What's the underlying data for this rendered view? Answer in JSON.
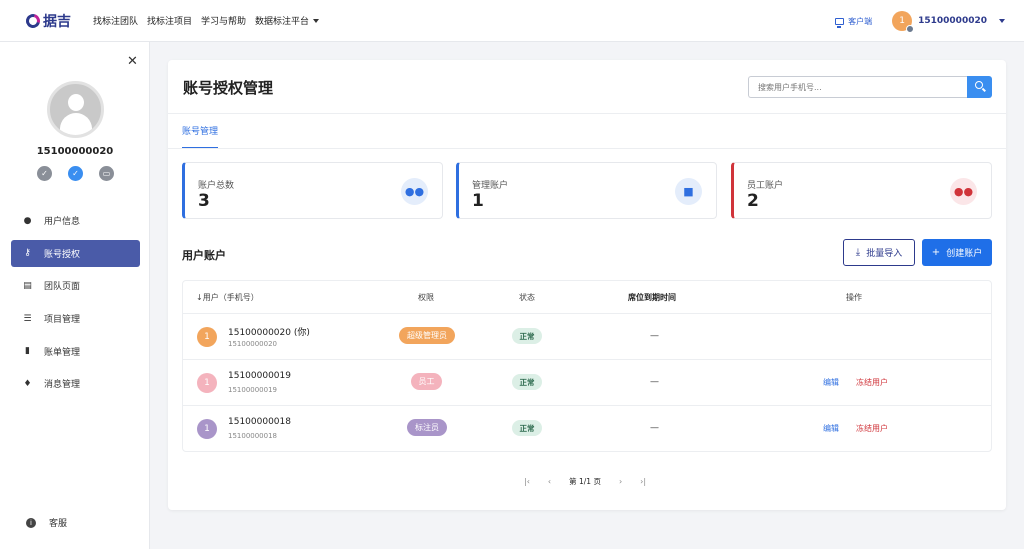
{
  "header": {
    "logo_text": "据吉",
    "nav": [
      "找标注团队",
      "找标注项目",
      "学习与帮助",
      "数据标注平台"
    ],
    "service_label": "客户端",
    "user_avatar": "1",
    "user_phone": "15100000020"
  },
  "sidebar": {
    "phone": "15100000020",
    "menu": [
      {
        "label": "用户信息",
        "icon": "person-icon"
      },
      {
        "label": "账号授权",
        "icon": "key-icon",
        "active": true
      },
      {
        "label": "团队页面",
        "icon": "store-icon"
      },
      {
        "label": "项目管理",
        "icon": "list-icon"
      },
      {
        "label": "账单管理",
        "icon": "bill-icon"
      },
      {
        "label": "消息管理",
        "icon": "bell-icon"
      }
    ],
    "service_label": "客服"
  },
  "main": {
    "title": "账号授权管理",
    "search_placeholder": "搜索用户手机号...",
    "tab": "账号管理",
    "stats": [
      {
        "label": "账户总数",
        "value": "3",
        "color": "#2f6fe0",
        "icon": "users-icon"
      },
      {
        "label": "管理账户",
        "value": "1",
        "color": "#2f6fe0",
        "icon": "lock-icon"
      },
      {
        "label": "员工账户",
        "value": "2",
        "color": "#d0343a",
        "icon": "users-icon"
      }
    ],
    "section_title": "用户账户",
    "import_label": "批量导入",
    "create_label": "创建账户",
    "table": {
      "headers": [
        "用户（手机号）",
        "权限",
        "状态",
        "席位到期时间",
        "操作"
      ],
      "rows": [
        {
          "avatar": "1",
          "avatar_color": "#f2a55c",
          "name": "15100000020 (你)",
          "sub": "15100000020",
          "role": "超级管理员",
          "role_color": "#f2a55c",
          "status": "正常",
          "expiry": "—",
          "edit": "",
          "freeze": ""
        },
        {
          "avatar": "1",
          "avatar_color": "#f4b3bd",
          "name": "15100000019",
          "sub": "15100000019",
          "role": "员工",
          "role_color": "#f4b3bd",
          "status": "正常",
          "expiry": "—",
          "edit": "编辑",
          "freeze": "冻结用户"
        },
        {
          "avatar": "1",
          "avatar_color": "#a995c9",
          "name": "15100000018",
          "sub": "15100000018",
          "role": "标注员",
          "role_color": "#a995c9",
          "status": "正常",
          "expiry": "—",
          "edit": "编辑",
          "freeze": "冻结用户"
        }
      ]
    },
    "pagination": {
      "text": "第 1/1 页"
    }
  }
}
